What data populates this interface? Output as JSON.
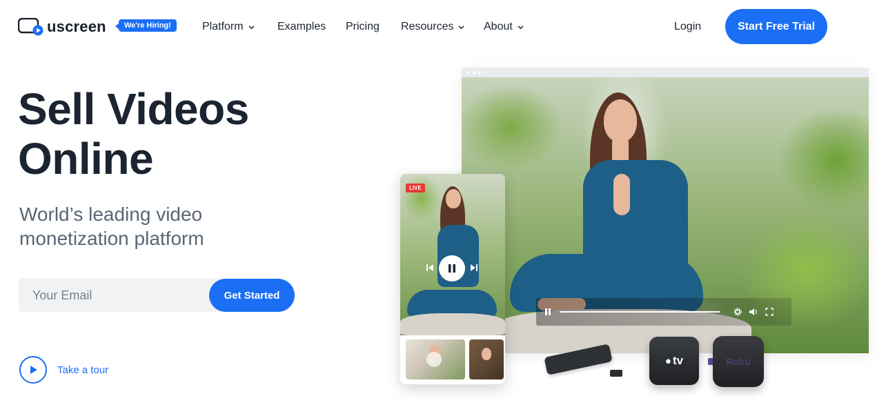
{
  "header": {
    "brand": "uscreen",
    "hiring_badge": "We're Hiring!",
    "nav": [
      {
        "label": "Platform",
        "has_dropdown": true
      },
      {
        "label": "Examples",
        "has_dropdown": false
      },
      {
        "label": "Pricing",
        "has_dropdown": false
      },
      {
        "label": "Resources",
        "has_dropdown": true
      },
      {
        "label": "About",
        "has_dropdown": true
      }
    ],
    "login_label": "Login",
    "cta_label": "Start Free Trial"
  },
  "hero": {
    "headline_line1": "Sell Videos",
    "headline_line2": "Online",
    "subhead_line1": "World’s leading video",
    "subhead_line2": "monetization platform",
    "email_placeholder": "Your Email",
    "get_started_label": "Get Started",
    "tour_label": "Take a tour"
  },
  "visual": {
    "live_badge": "LIVE",
    "appletv_label": "tv",
    "roku_label": "Roku",
    "icons": [
      "pause-icon",
      "settings-icon",
      "volume-icon",
      "fullscreen-icon",
      "play-icon",
      "skip-back-icon",
      "skip-forward-icon",
      "chevron-down-icon"
    ]
  },
  "colors": {
    "accent": "#1b6ff5",
    "heading": "#1b2430",
    "subtext": "#5a6674",
    "live": "#e53935"
  }
}
